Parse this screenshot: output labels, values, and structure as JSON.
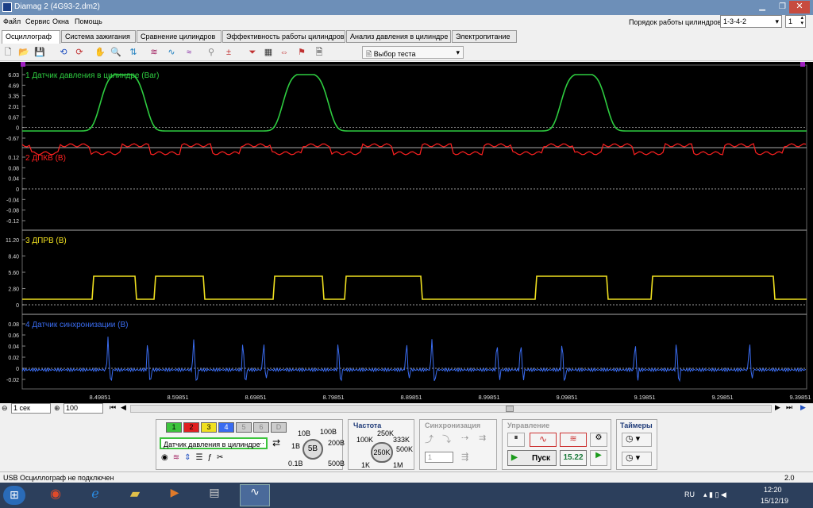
{
  "window": {
    "title": "Diamag 2 (4G93-2.dm2)"
  },
  "menu": [
    "Файл",
    "Сервис",
    "Окна",
    "Помощь"
  ],
  "tabs": [
    "Осциллограф",
    "Система зажигания",
    "Сравнение цилиндров",
    "Эффективность работы цилиндров",
    "Анализ давления в цилиндре",
    "Электропитание"
  ],
  "cylinder_order": {
    "label": "Порядок работы цилиндров",
    "value": "1-3-4-2",
    "spin": "1"
  },
  "toolbar": {
    "test_select": "Выбор теста"
  },
  "channels": [
    {
      "title": "1 Датчик давления в цилиндре (Bar)",
      "color": "#2ecc40",
      "ticks": [
        "6.03",
        "4.69",
        "3.35",
        "2.01",
        "0.67",
        "0",
        "-0.67"
      ]
    },
    {
      "title": "2 ДПКВ (В)",
      "color": "#ff2020",
      "ticks": [
        "0.12",
        "0.08",
        "0.04",
        "0",
        "-0.04",
        "-0.08",
        "-0.12"
      ]
    },
    {
      "title": "3 ДПРВ (В)",
      "color": "#f0e020",
      "ticks": [
        "11.20",
        "8.40",
        "5.60",
        "2.80",
        "0"
      ]
    },
    {
      "title": "4 Датчик синхронизации (В)",
      "color": "#3a6cf0",
      "ticks": [
        "0.08",
        "0.06",
        "0.04",
        "0.02",
        "0",
        "-0.02"
      ]
    }
  ],
  "time_axis": [
    "8.49851",
    "8.59851",
    "8.69851",
    "8.79851",
    "8.89851",
    "8.99851",
    "9.09851",
    "9.19851",
    "9.29851",
    "9.39851"
  ],
  "controls": {
    "timebase": "1 сек",
    "zoom": "100",
    "channel_buttons": [
      "1",
      "2",
      "3",
      "4",
      "5",
      "6",
      "D"
    ],
    "channel_name": "Датчик давления в цилиндре",
    "voltage_labels": [
      "10В",
      "100В",
      "1В",
      "200В",
      "0.1В",
      "500В"
    ],
    "voltage_value": "5В",
    "freq_title": "Частота",
    "freq_labels": [
      "250K",
      "100K",
      "333K",
      "500K",
      "1K",
      "1M"
    ],
    "freq_value": "250K",
    "sync_title": "Синхронизация",
    "sync_value": "1",
    "control_title": "Управление",
    "start_label": "Пуск",
    "time_value": "15.22",
    "timers_title": "Таймеры"
  },
  "status": {
    "left": "USB Осциллограф не подключен",
    "right": "2.0"
  },
  "tray": {
    "lang": "RU",
    "time": "12:20",
    "date": "15/12/19"
  }
}
